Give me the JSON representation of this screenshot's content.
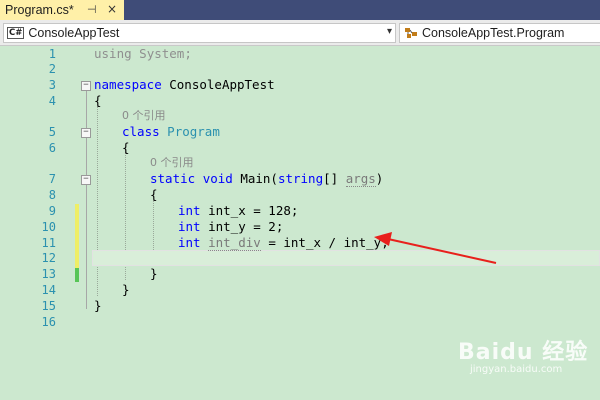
{
  "tab": {
    "title": "Program.cs*",
    "pin": "⊣",
    "close": "×"
  },
  "navbar": {
    "project_badge": "C#",
    "project_name": "ConsoleAppTest",
    "class_name": "ConsoleAppTest.Program"
  },
  "editor": {
    "line_numbers": [
      "1",
      "2",
      "3",
      "4",
      "5",
      "6",
      "7",
      "8",
      "9",
      "10",
      "11",
      "12",
      "13",
      "14",
      "15",
      "16"
    ],
    "references_1": "0 个引用",
    "references_2": "0 个引用",
    "code": {
      "using_kw": "using",
      "using_rest": " System;",
      "namespace_kw": "namespace",
      "namespace_name": " ConsoleAppTest",
      "open_brace": "{",
      "close_brace": "}",
      "class_kw": "class",
      "class_name": "Program",
      "static_kw": "static",
      "void_kw": "void",
      "main_name": " Main(",
      "string_kw": "string",
      "main_args": "[] ",
      "args_name": "args",
      "main_close": ")",
      "int_kw": "int",
      "line9_rest": " int_x = 128;",
      "line10_rest": " int_y = 2;",
      "line11_var": "int_div",
      "line11_rest": " = int_x / int_y;"
    },
    "change_colors": {
      "unsaved": "#eeee66",
      "saved": "#57c557"
    }
  },
  "annotation": {
    "arrow_color": "#e8201c"
  },
  "watermark": {
    "main": "Baidu 经验",
    "sub": "jingyan.baidu.com"
  }
}
